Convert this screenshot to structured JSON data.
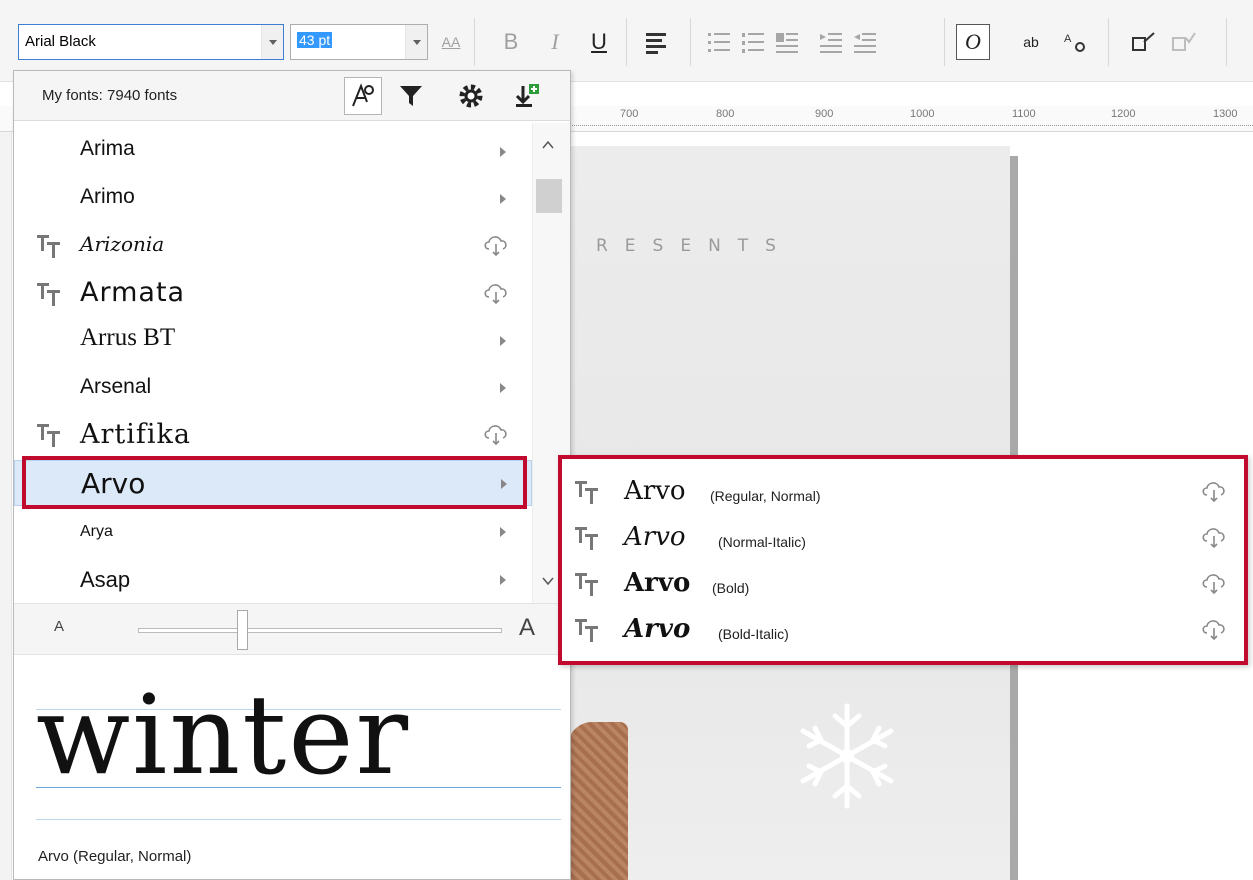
{
  "toolbar": {
    "font_value": "Arial Black",
    "size_value": "43 pt",
    "bold": "B",
    "italic": "I",
    "underline": "U",
    "italic_o": "O",
    "ab_label": "ab",
    "aa_label": "AA"
  },
  "ruler": {
    "ticks": [
      "700",
      "800",
      "900",
      "1000",
      "1100",
      "1200",
      "1300"
    ]
  },
  "panel": {
    "count": "My fonts: 7940 fonts"
  },
  "fonts": [
    {
      "label": "Arima"
    },
    {
      "label": "Arimo"
    },
    {
      "label": "Arizonia"
    },
    {
      "label": "Armata"
    },
    {
      "label": "Arrus BT"
    },
    {
      "label": "Arsenal"
    },
    {
      "label": "Artifika"
    },
    {
      "label": "Arvo"
    },
    {
      "label": "Arya"
    },
    {
      "label": "Asap"
    }
  ],
  "slider": {
    "small_label": "A",
    "big_label": "A"
  },
  "preview": {
    "word": "winter",
    "caption": "Arvo (Regular, Normal)"
  },
  "submenu": {
    "items": [
      {
        "name": "Arvo",
        "style": "(Regular, Normal)"
      },
      {
        "name": "Arvo",
        "style": "(Normal-Italic)"
      },
      {
        "name": "Arvo",
        "style": "(Bold)"
      },
      {
        "name": "Arvo",
        "style": "(Bold-Italic)"
      }
    ]
  },
  "canvas": {
    "presents": "RESENTS"
  },
  "colors": {
    "highlight": "#c00a2e",
    "selection": "#dbe9f8",
    "accent": "#3399ff"
  }
}
